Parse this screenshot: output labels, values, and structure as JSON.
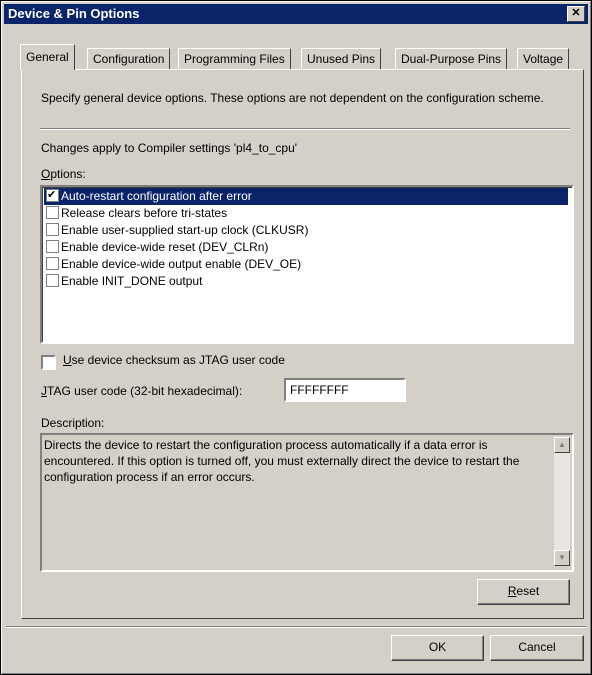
{
  "window": {
    "title": "Device & Pin Options",
    "close_glyph": "✕"
  },
  "tabs": [
    {
      "label": "General",
      "active": true
    },
    {
      "label": "Configuration"
    },
    {
      "label": "Programming Files"
    },
    {
      "label": "Unused Pins"
    },
    {
      "label": "Dual-Purpose Pins"
    },
    {
      "label": "Voltage"
    }
  ],
  "general": {
    "intro": "Specify general device options.  These options are not dependent on the configuration scheme.",
    "changes_note": "Changes apply to Compiler settings 'pl4_to_cpu'",
    "options_label_first": "O",
    "options_label_rest": "ptions:",
    "options": [
      {
        "label": "Auto-restart configuration after error",
        "checked": true,
        "selected": true
      },
      {
        "label": "Release clears before tri-states",
        "checked": false
      },
      {
        "label": "Enable user-supplied start-up clock (CLKUSR)",
        "checked": false
      },
      {
        "label": "Enable device-wide reset (DEV_CLRn)",
        "checked": false
      },
      {
        "label": "Enable device-wide output enable (DEV_OE)",
        "checked": false
      },
      {
        "label": "Enable INIT_DONE output",
        "checked": false
      }
    ],
    "checksum_first": "U",
    "checksum_rest": "se device checksum as JTAG user code",
    "jtag_first": "J",
    "jtag_rest": "TAG user code (32-bit hexadecimal):",
    "jtag_value": "FFFFFFFF",
    "description_label": "Description:",
    "description_text": "Directs the device to restart the configuration process automatically if a data error is encountered. If this option is turned off, you must externally direct the device to restart the configuration process if an error occurs.",
    "reset_first": "R",
    "reset_rest": "eset"
  },
  "footer": {
    "ok_label": "OK",
    "cancel_label": "Cancel"
  }
}
